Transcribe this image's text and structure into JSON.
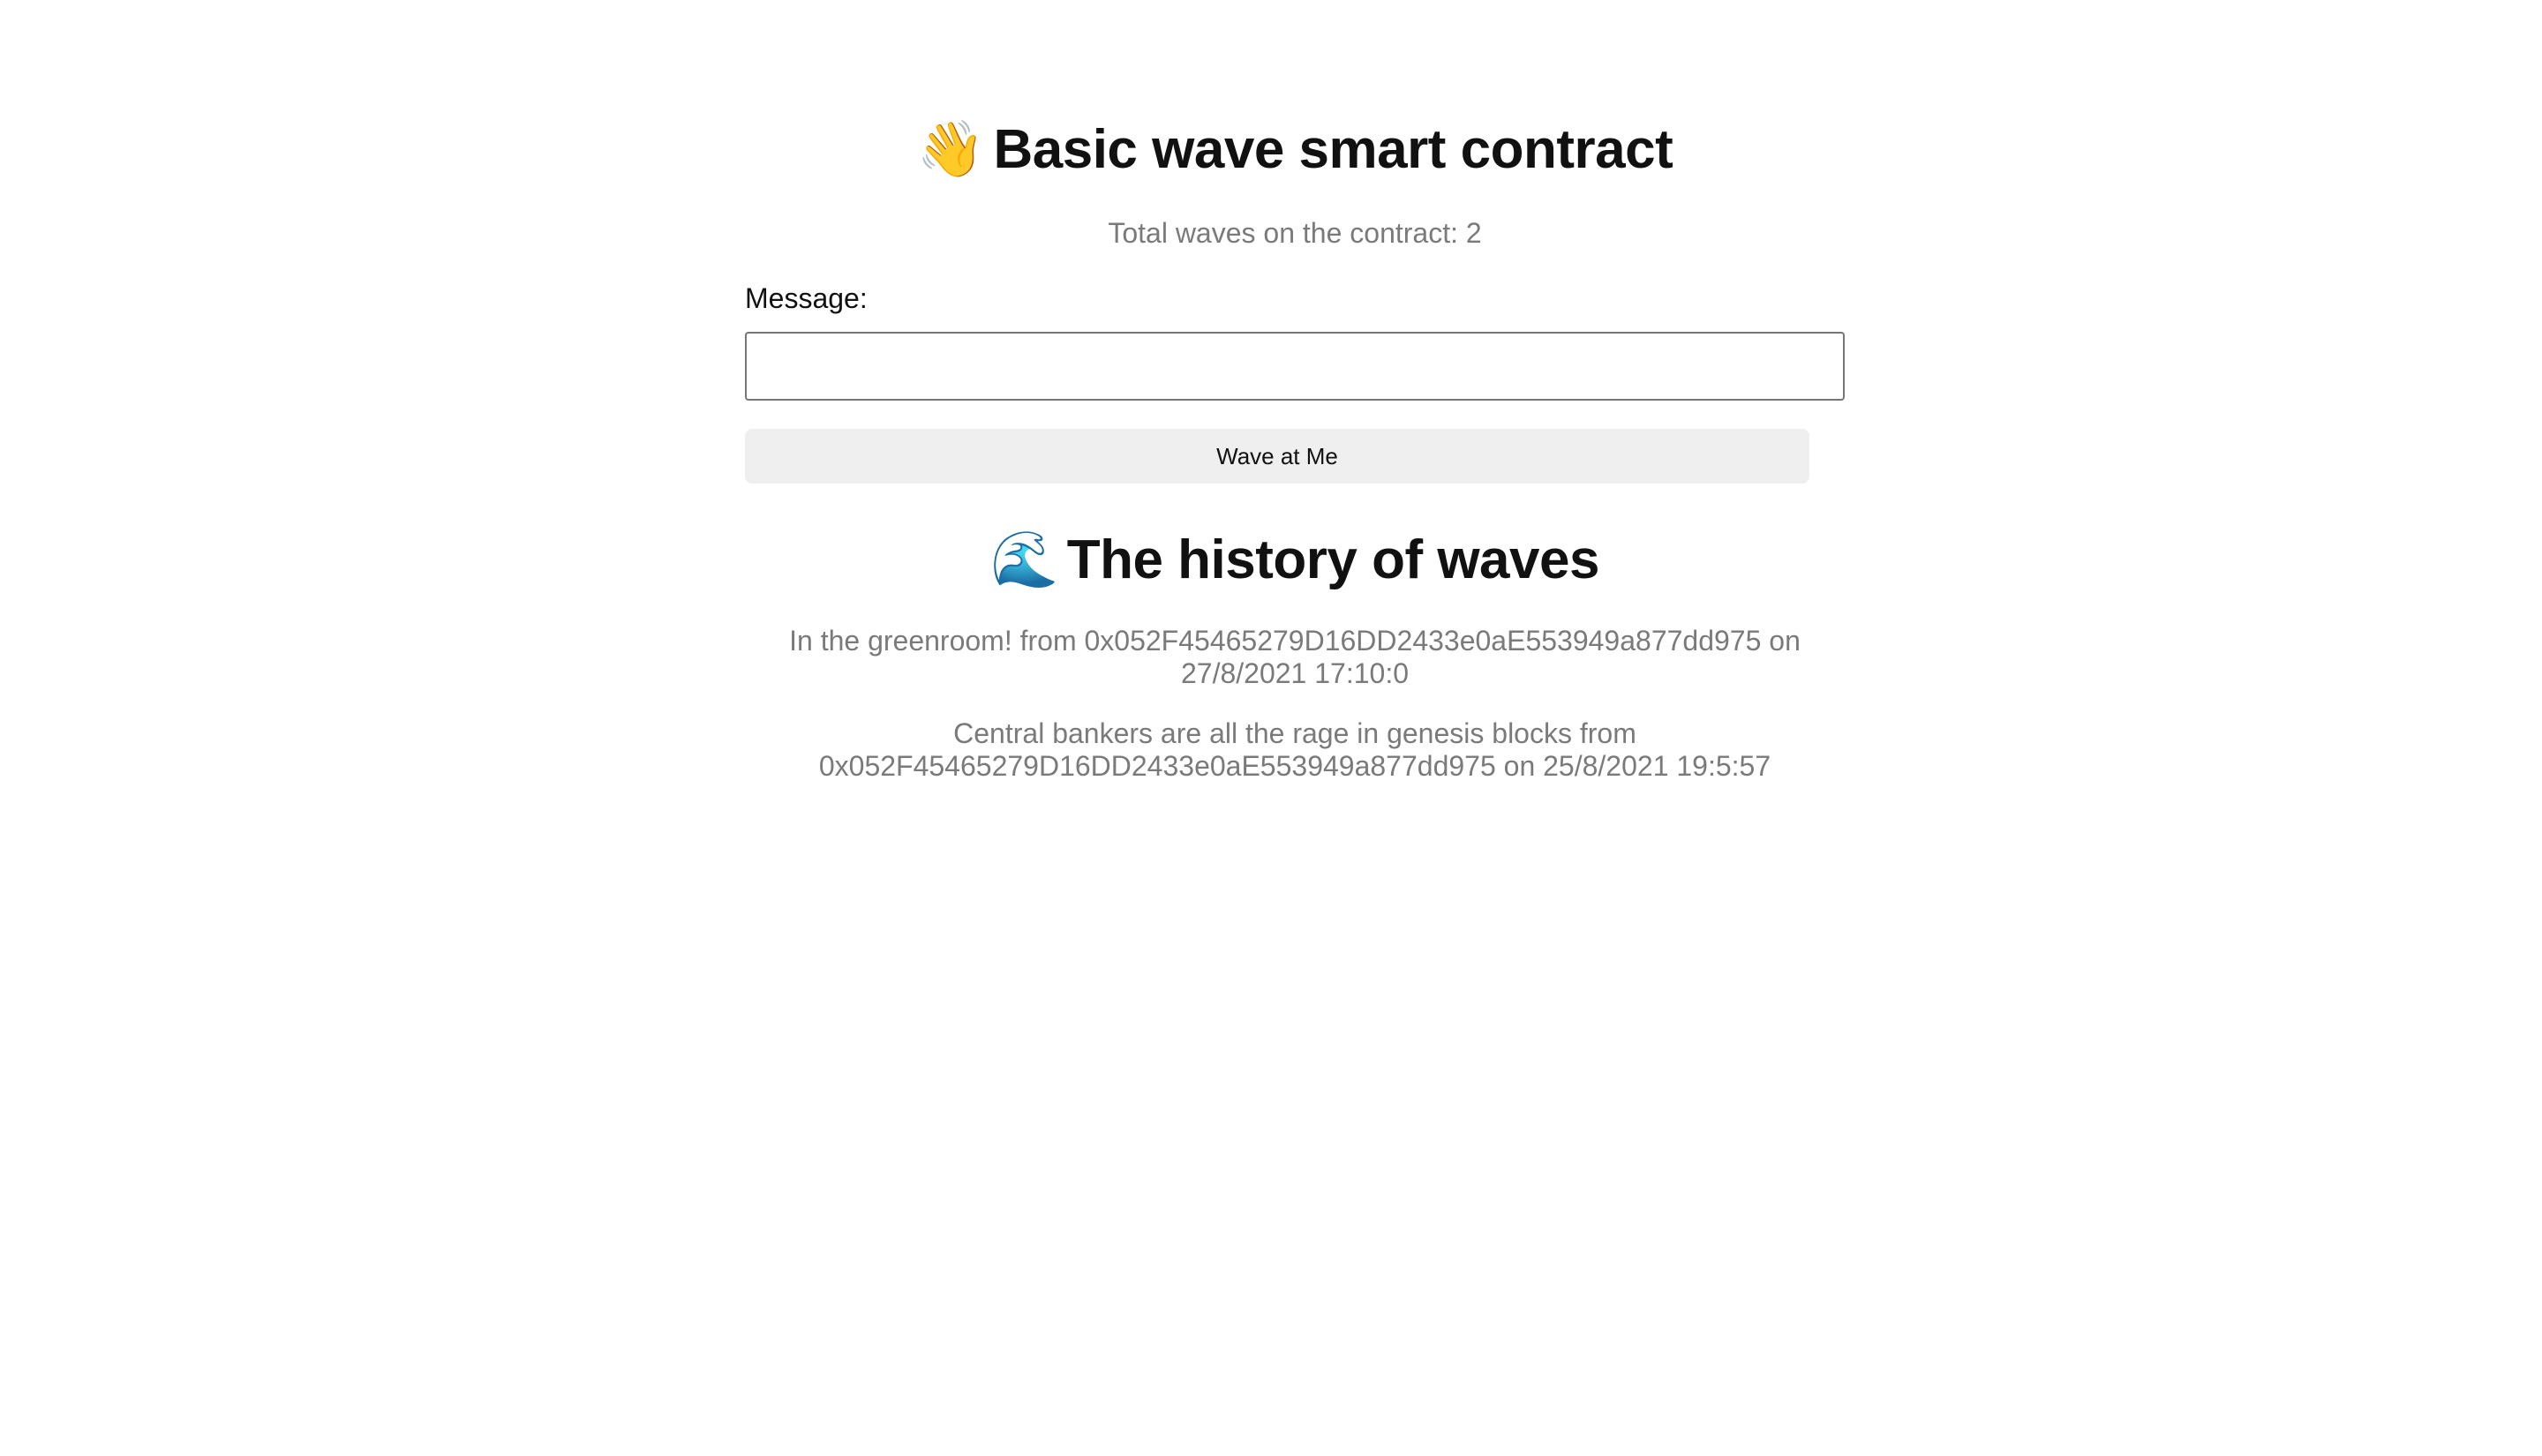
{
  "header": {
    "emoji": "👋",
    "title": "Basic wave smart contract",
    "total_waves_text": "Total waves on the contract: 2"
  },
  "form": {
    "message_label": "Message:",
    "message_value": "",
    "message_placeholder": "",
    "wave_button_label": "Wave at Me"
  },
  "history": {
    "emoji": "🌊",
    "title": "The history of waves",
    "entries": [
      {
        "text": "In the greenroom! from 0x052F45465279D16DD2433e0aE553949a877dd975 on 27/8/2021 17:10:0"
      },
      {
        "text": "Central bankers are all the rage in genesis blocks from 0x052F45465279D16DD2433e0aE553949a877dd975 on 25/8/2021 19:5:57"
      }
    ]
  }
}
